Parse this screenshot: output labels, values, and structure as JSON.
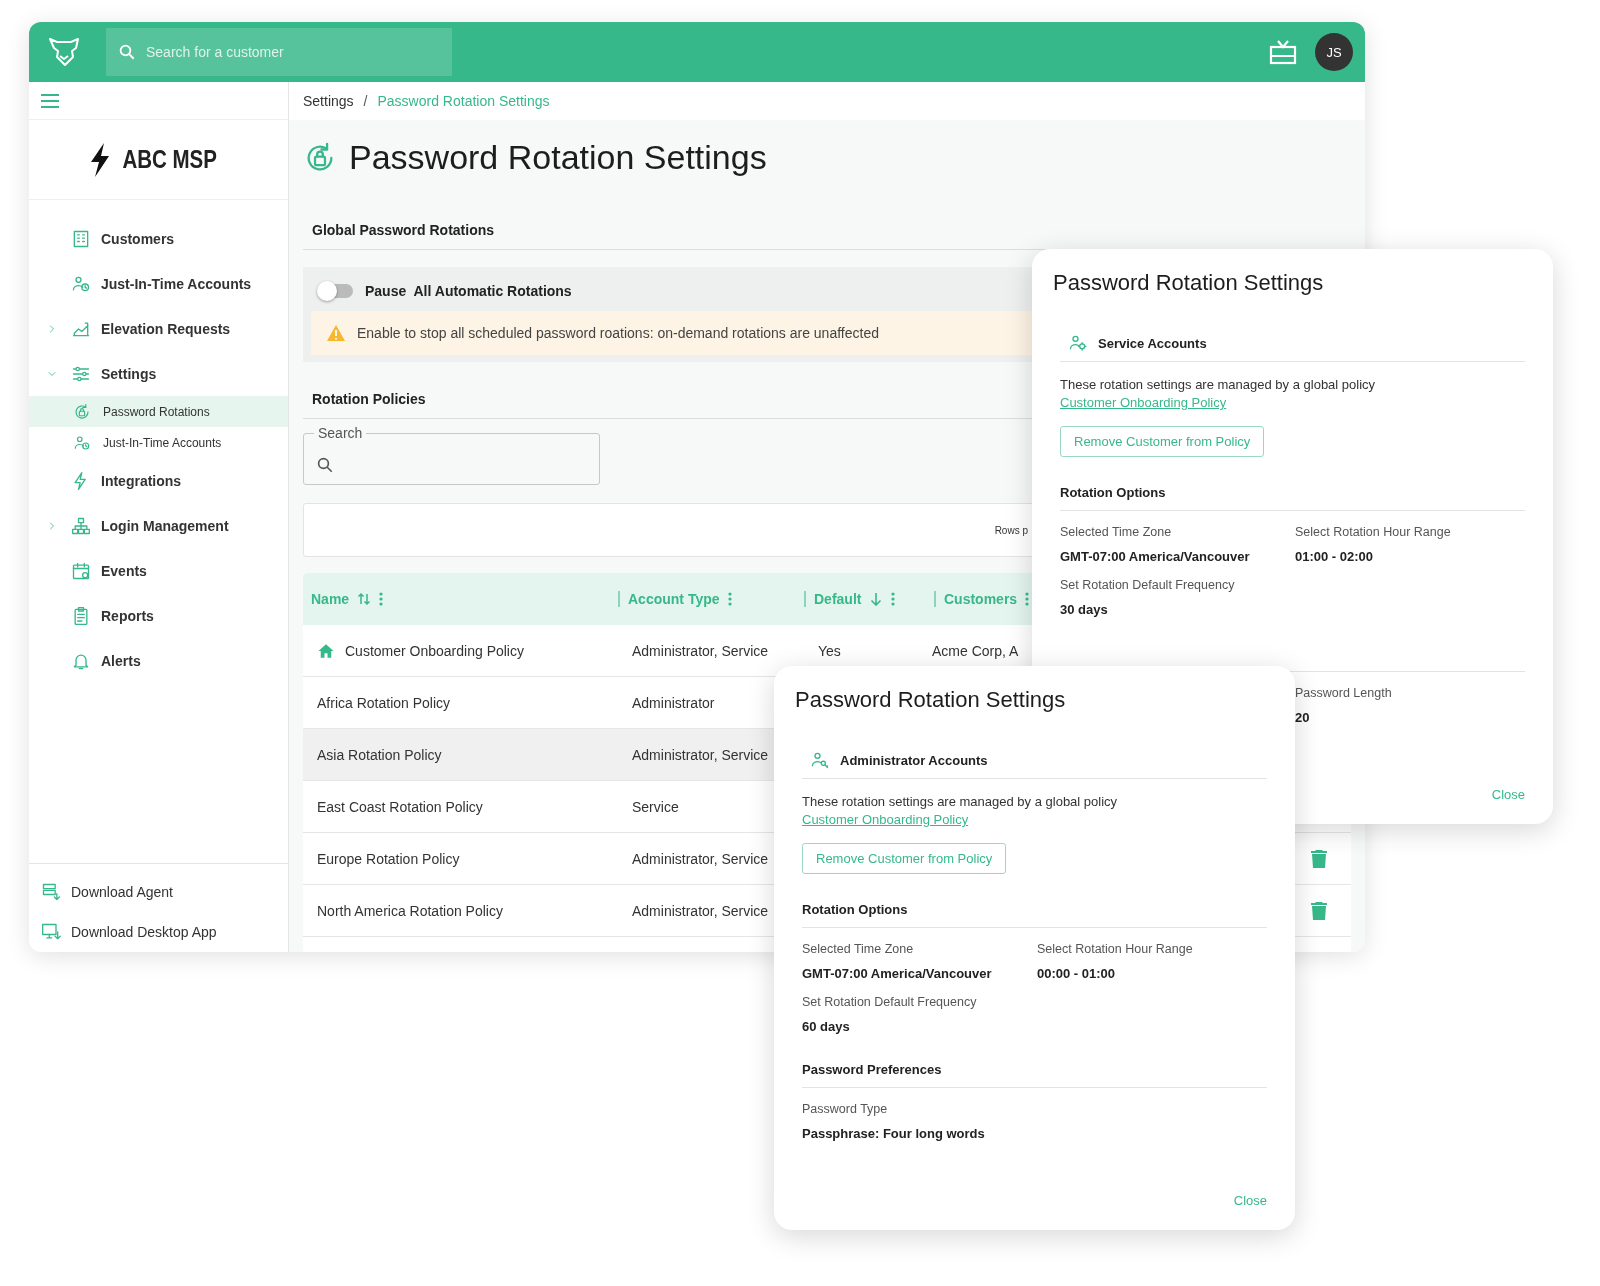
{
  "header": {
    "search": {
      "placeholder": "Search for a customer"
    },
    "avatar": "JS"
  },
  "sidebar": {
    "logo": "ABC MSP",
    "items": [
      {
        "label": "Customers",
        "expandable": false,
        "selected": false
      },
      {
        "label": "Just-In-Time Accounts",
        "expandable": false,
        "selected": false
      },
      {
        "label": "Elevation Requests",
        "expandable": true,
        "expanded": false,
        "selected": false
      },
      {
        "label": "Settings",
        "expandable": true,
        "expanded": true,
        "selected": false,
        "children": [
          {
            "label": "Password Rotations",
            "selected": true
          },
          {
            "label": "Just-In-Time Accounts",
            "selected": false
          }
        ]
      },
      {
        "label": "Integrations",
        "expandable": false,
        "selected": false
      },
      {
        "label": "Login Management",
        "expandable": true,
        "expanded": false,
        "selected": false
      },
      {
        "label": "Events",
        "expandable": false,
        "selected": false
      },
      {
        "label": "Reports",
        "expandable": false,
        "selected": false
      },
      {
        "label": "Alerts",
        "expandable": false,
        "selected": false
      }
    ],
    "footer_items": [
      "Download Agent",
      "Download Desktop App"
    ]
  },
  "breadcrumb": {
    "separator": "/",
    "items": [
      {
        "label": "Settings",
        "current": false
      },
      {
        "label": "Password Rotation Settings",
        "current": true
      }
    ]
  },
  "page": {
    "title": "Password Rotation Settings",
    "global_section": {
      "heading": "Global Password Rotations",
      "toggle": {
        "label": "Pause  All Automatic Rotations",
        "on": false
      },
      "warning": "Enable to stop all scheduled password roations: on-demand rotations are unaffected"
    },
    "policies_section": {
      "heading": "Rotation Policies",
      "search": {
        "label": "Search"
      },
      "rows_per_page_label": "Rows p",
      "table": {
        "columns": [
          {
            "label": "Name",
            "sortable": true,
            "sorted": false
          },
          {
            "label": "Account Type",
            "sortable": false,
            "sorted": false
          },
          {
            "label": "Default",
            "sortable": true,
            "sorted": true
          },
          {
            "label": "Customers",
            "sortable": false,
            "sorted": false
          }
        ],
        "rows": [
          {
            "name": "Customer Onboarding Policy",
            "global": true,
            "account_type": "Administrator, Service",
            "default": "Yes",
            "customers": "Acme Corp, A",
            "hovered": false
          },
          {
            "name": "Africa Rotation Policy",
            "global": false,
            "account_type": "Administrator",
            "hovered": false
          },
          {
            "name": "Asia Rotation Policy",
            "global": false,
            "account_type": "Administrator, Service",
            "hovered": true
          },
          {
            "name": "East Coast Rotation Policy",
            "global": false,
            "account_type": "Service",
            "hovered": false
          },
          {
            "name": "Europe Rotation Policy",
            "global": false,
            "account_type": "Administrator, Service",
            "hovered": false,
            "trash": true
          },
          {
            "name": "North America Rotation Policy",
            "global": false,
            "account_type": "Administrator, Service",
            "hovered": false,
            "trash": true
          }
        ]
      }
    }
  },
  "dialogs": [
    {
      "title": "Password Rotation Settings",
      "kind": "service",
      "account_type": "Service Accounts",
      "note": "These rotation settings are managed by a global policy",
      "note_link": "Customer Onboarding Policy",
      "button": "Remove Customer from Policy",
      "sections": [
        {
          "kind": "full",
          "heading": "Rotation Options",
          "fields": [
            {
              "label": "Selected Time Zone",
              "value": "GMT-07:00 America/Vancouver"
            },
            {
              "label": "Select Rotation Hour Range",
              "value": "01:00 - 02:00"
            },
            {
              "label": "Set Rotation Default Frequency",
              "value": "30 days"
            }
          ]
        },
        {
          "kind": "covered",
          "fields": [
            {
              "label": "Password Length",
              "value": "20"
            }
          ]
        }
      ],
      "close": "Close"
    },
    {
      "title": "Password Rotation Settings",
      "kind": "admin",
      "account_type": "Administrator Accounts",
      "note": "These rotation settings are managed by a global policy",
      "note_link": "Customer Onboarding Policy",
      "button": "Remove Customer from Policy",
      "sections": [
        {
          "kind": "full",
          "heading": "Rotation Options",
          "fields": [
            {
              "label": "Selected Time Zone",
              "value": "GMT-07:00 America/Vancouver"
            },
            {
              "label": "Select Rotation Hour Range",
              "value": "00:00 - 01:00"
            },
            {
              "label": "Set Rotation Default Frequency",
              "value": "60 days"
            }
          ]
        },
        {
          "kind": "full",
          "heading": "Password Preferences",
          "fields": [
            {
              "label": "Password Type",
              "value": "Passphrase: Four long words"
            }
          ]
        }
      ],
      "close": "Close"
    }
  ]
}
